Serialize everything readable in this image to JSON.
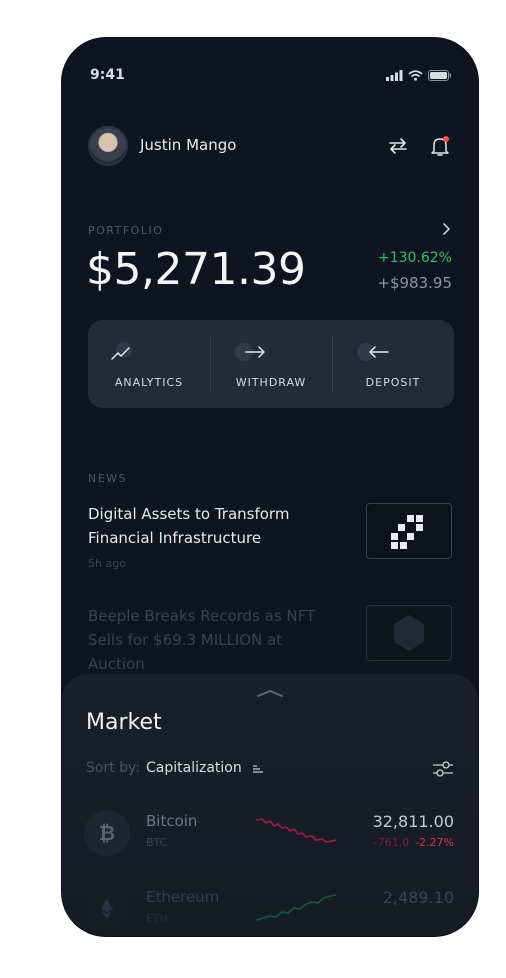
{
  "status": {
    "time": "9:41"
  },
  "user": {
    "name": "Justin Mango"
  },
  "portfolio": {
    "label": "PORTFOLIO",
    "balance": "$5,271.39",
    "change_pct": "+130.62%",
    "change_abs": "+$983.95"
  },
  "actions": [
    {
      "label": "ANALYTICS",
      "icon": "analytics-icon"
    },
    {
      "label": "WITHDRAW",
      "icon": "arrow-right-icon"
    },
    {
      "label": "DEPOSIT",
      "icon": "arrow-left-icon"
    }
  ],
  "news": {
    "label": "NEWS",
    "items": [
      {
        "title": "Digital Assets to Transform Financial Infrastructure",
        "time": "5h ago"
      },
      {
        "title": "Beeple Breaks Records as NFT Sells for $69.3 MILLION at Auction"
      }
    ]
  },
  "market": {
    "title": "Market",
    "sort_label": "Sort by:",
    "sort_value": "Capitalization",
    "coins": [
      {
        "name": "Bitcoin",
        "symbol": "BTC",
        "price": "32,811.00",
        "change_abs": "-761.0",
        "change_pct": "-2.27%",
        "trend": "down"
      },
      {
        "name": "Ethereum",
        "symbol": "ETH",
        "price": "2,489.10",
        "change_abs": "",
        "change_pct": "",
        "trend": "up"
      }
    ]
  },
  "colors": {
    "background": "#0f1420",
    "card": "#242b38",
    "positive": "#2fbf6b",
    "negative": "#d23a48",
    "notification_dot": "#ff4d4f"
  }
}
